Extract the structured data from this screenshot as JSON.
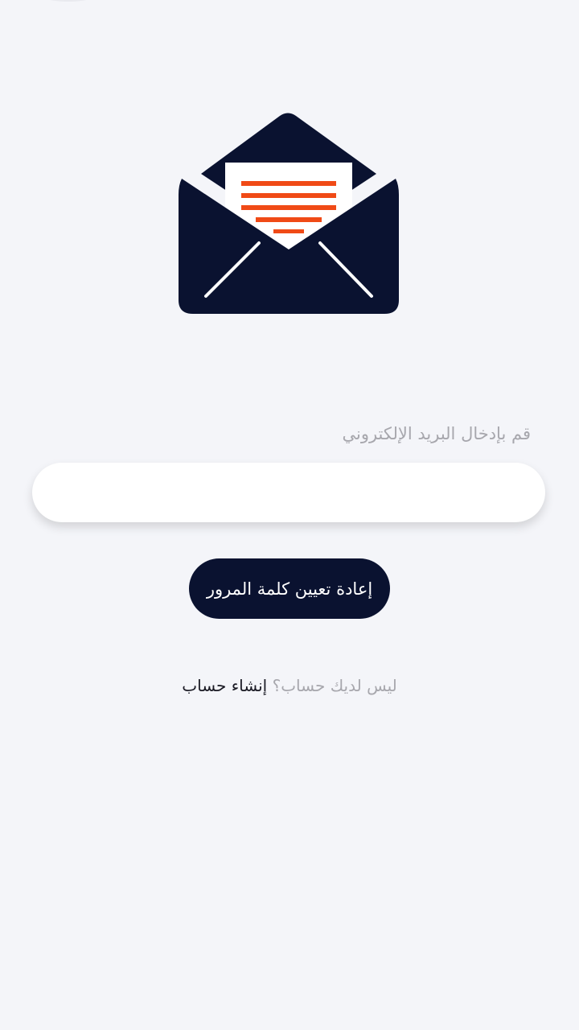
{
  "form": {
    "email_label": "قم بإدخال البريد الإلكتروني",
    "email_value": "",
    "reset_button_label": "إعادة تعيين كلمة المرور"
  },
  "footer": {
    "question": "ليس لديك حساب؟",
    "signup_link": "إنشاء حساب"
  },
  "logo": {
    "icon": "open-envelope-icon",
    "envelope_color": "#0a1230",
    "stripes_color": "#f04a16"
  },
  "colors": {
    "background": "#f4f5f9",
    "primary": "#0a1230",
    "muted_text": "#a7a7ad"
  }
}
